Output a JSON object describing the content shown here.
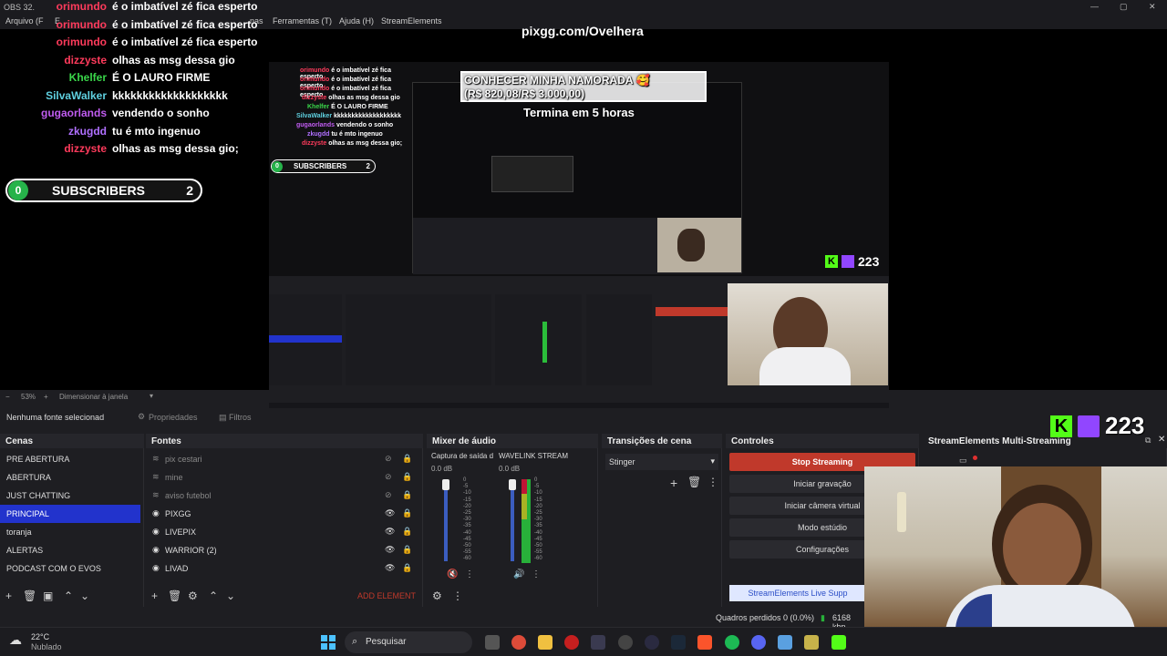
{
  "window": {
    "title": "OBS 32.",
    "controls": [
      "—",
      "▢",
      "✕"
    ]
  },
  "menu": {
    "items": [
      "Arquivo (F",
      "E",
      "nas",
      "Ferramentas (T)",
      "Ajuda (H)",
      "StreamElements"
    ]
  },
  "overlay": {
    "url": "pixgg.com/Ovelhera",
    "goal_title": "CONHECER MINHA NAMORADA 🥰",
    "goal_amount": "(R$ 820,08/R$ 3.000,00)",
    "goal_time": "Termina em 5 horas",
    "viewer_count": "223",
    "subs_left": "0",
    "subs_label": "SUBSCRIBERS",
    "subs_right": "2",
    "chat": [
      {
        "user": "orimundo",
        "msg": "é o imbatível zé fica esperto",
        "color": "#ff3b5c"
      },
      {
        "user": "orimundo",
        "msg": "é o imbatível zé fica esperto",
        "color": "#ff3b5c"
      },
      {
        "user": "orimundo",
        "msg": "é o imbatível zé fica esperto",
        "color": "#ff3b5c"
      },
      {
        "user": "dizzyste",
        "msg": "olhas as msg dessa gio",
        "color": "#ff3b5c"
      },
      {
        "user": "Khelfer",
        "msg": "É O LAURO FIRME",
        "color": "#3ad64a"
      },
      {
        "user": "SilvaWalker",
        "msg": "kkkkkkkkkkkkkkkkkkk",
        "color": "#5fd0e0"
      },
      {
        "user": "gugaorlands",
        "msg": "vendendo o sonho",
        "color": "#c05cf0"
      },
      {
        "user": "zkugdd",
        "msg": "tu é mto ingenuo",
        "color": "#b070ff"
      },
      {
        "user": "dizzyste",
        "msg": "olhas as msg dessa gio;",
        "color": "#ff3b5c"
      }
    ]
  },
  "preview_status": {
    "zoom": "53%",
    "resize": "Dimensionar à janela"
  },
  "source_bar": {
    "no_source": "Nenhuma fonte selecionad",
    "properties": "Propriedades",
    "filters": "Filtros"
  },
  "scenes": {
    "title": "Cenas",
    "items": [
      "PRE ABERTURA",
      "ABERTURA",
      "JUST CHATTING",
      "PRINCIPAL",
      "toranja",
      "ALERTAS",
      "PODCAST COM O EVOS"
    ],
    "selected": "PRINCIPAL"
  },
  "sources": {
    "title": "Fontes",
    "items": [
      "pix cestari",
      "mine",
      "aviso futebol",
      "PIXGG",
      "LIVEPIX",
      "WARRIOR (2)",
      "LIVAD"
    ],
    "add_element": "ADD ELEMENT"
  },
  "mixer": {
    "title": "Mixer de áudio",
    "channels": [
      {
        "name": "Captura de saída d",
        "db": "0.0 dB"
      },
      {
        "name": "WAVELINK STREAM",
        "db": "0.0 dB"
      }
    ],
    "scale": [
      "0",
      "-5",
      "-10",
      "-15",
      "-20",
      "-25",
      "-30",
      "-35",
      "-40",
      "-45",
      "-50",
      "-55",
      "-60"
    ]
  },
  "transitions": {
    "title": "Transições de cena",
    "value": "Stinger"
  },
  "controls": {
    "title": "Controles",
    "stop_streaming": "Stop Streaming",
    "start_recording": "Iniciar gravação",
    "virtual_cam": "Iniciar câmera virtual",
    "studio_mode": "Modo estúdio",
    "settings": "Configurações",
    "se_live": "StreamElements Live Supp"
  },
  "streamelements": {
    "title": "StreamElements Multi-Streaming"
  },
  "statusbar": {
    "dropped": "Quadros perdidos 0 (0.0%)",
    "bitrate": "6168 kbp"
  },
  "taskbar": {
    "temp": "22°C",
    "weather": "Nublado",
    "search": "Pesquisar"
  },
  "colors": {
    "stop": "#c0392b",
    "selected": "#2233cc",
    "kick": "#53fc18",
    "twitch": "#9146ff",
    "subs_green": "#26b34a"
  }
}
